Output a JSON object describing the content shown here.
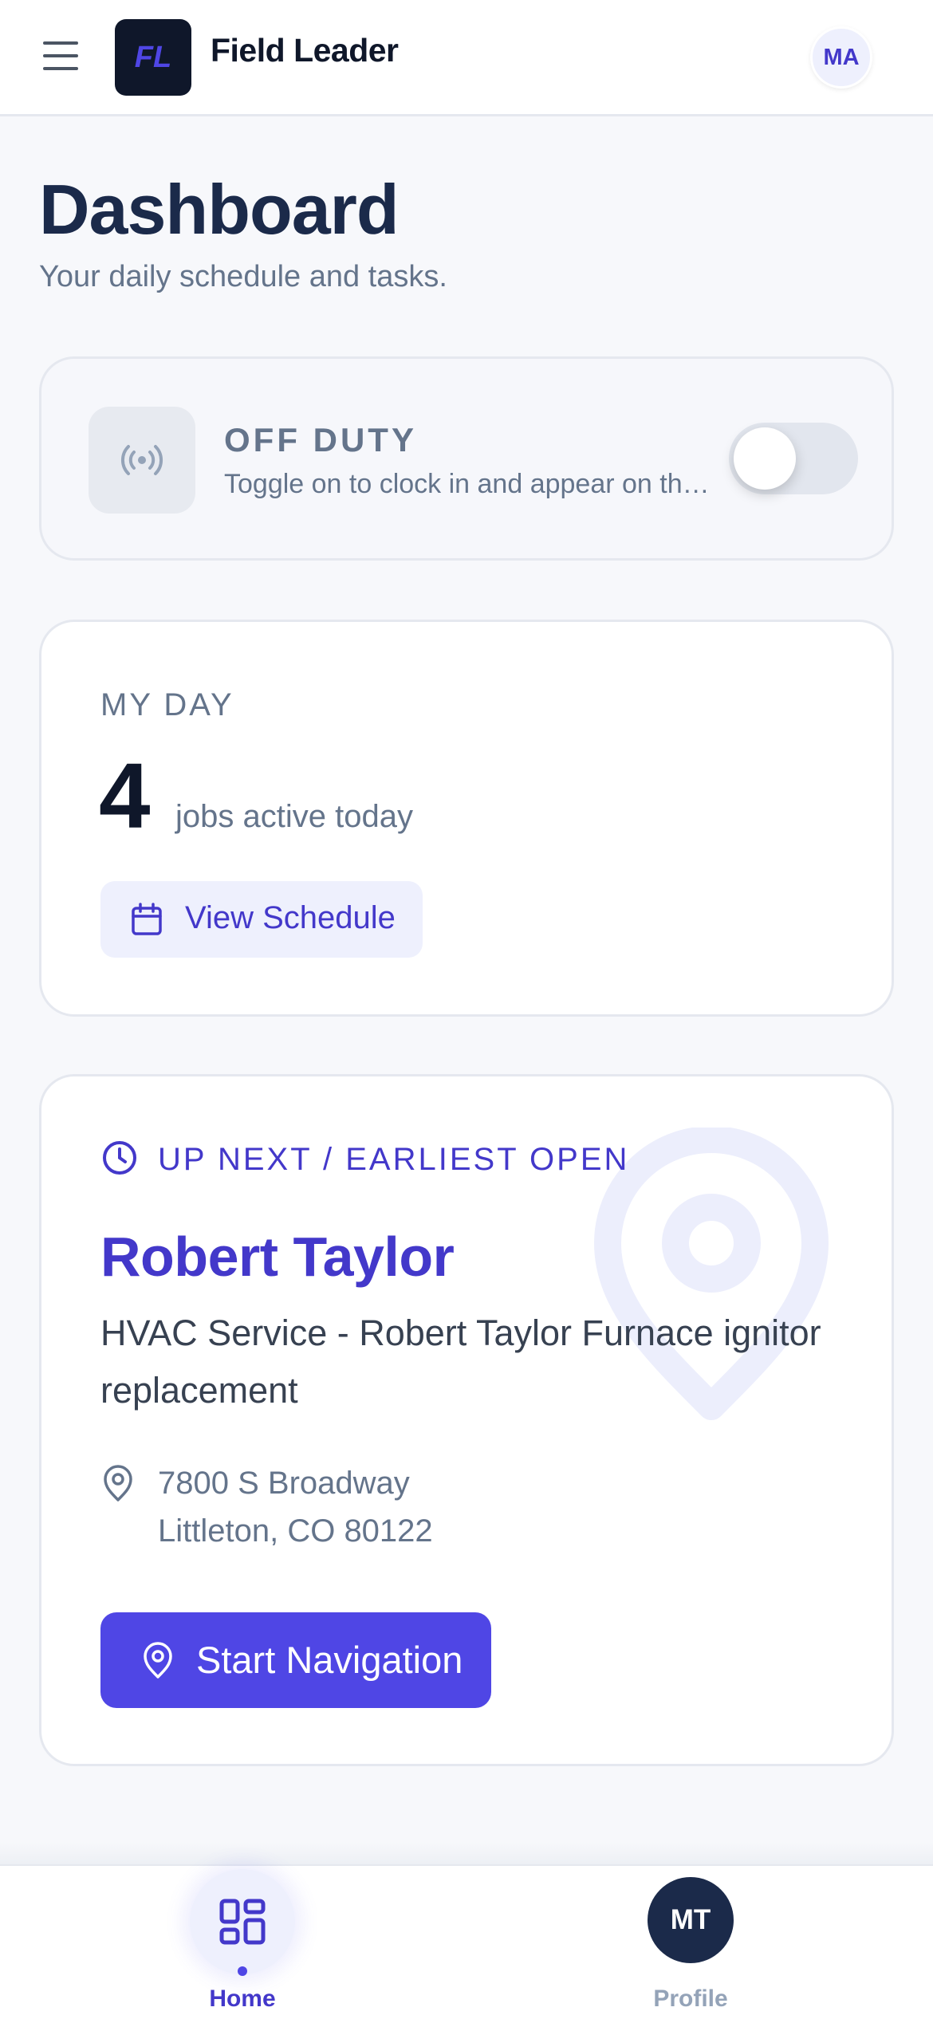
{
  "header": {
    "logo_text": "FL",
    "app_name": "Field Leader",
    "user_initials": "MA"
  },
  "page": {
    "title": "Dashboard",
    "subtitle": "Your daily schedule and tasks."
  },
  "duty": {
    "status": "OFF DUTY",
    "description": "Toggle on to clock in and appear on th…",
    "toggle_on": false,
    "icon": "broadcast-icon"
  },
  "my_day": {
    "label": "MY DAY",
    "count": "4",
    "count_text": "jobs active today",
    "button_label": "View Schedule",
    "button_icon": "calendar-icon"
  },
  "next_job": {
    "label": "UP NEXT / EARLIEST OPEN",
    "client_name": "Robert Taylor",
    "description": "HVAC Service - Robert Taylor Furnace ignitor replacement",
    "address_line1": "7800 S Broadway",
    "address_line2": "Littleton, CO 80122",
    "button_label": "Start Navigation"
  },
  "bottom_nav": {
    "home_label": "Home",
    "profile_label": "Profile",
    "profile_initials": "MT"
  },
  "colors": {
    "accent": "#4f46e5",
    "accent_text": "#4338ca",
    "navy": "#1b2a4a",
    "muted": "#64748b"
  }
}
